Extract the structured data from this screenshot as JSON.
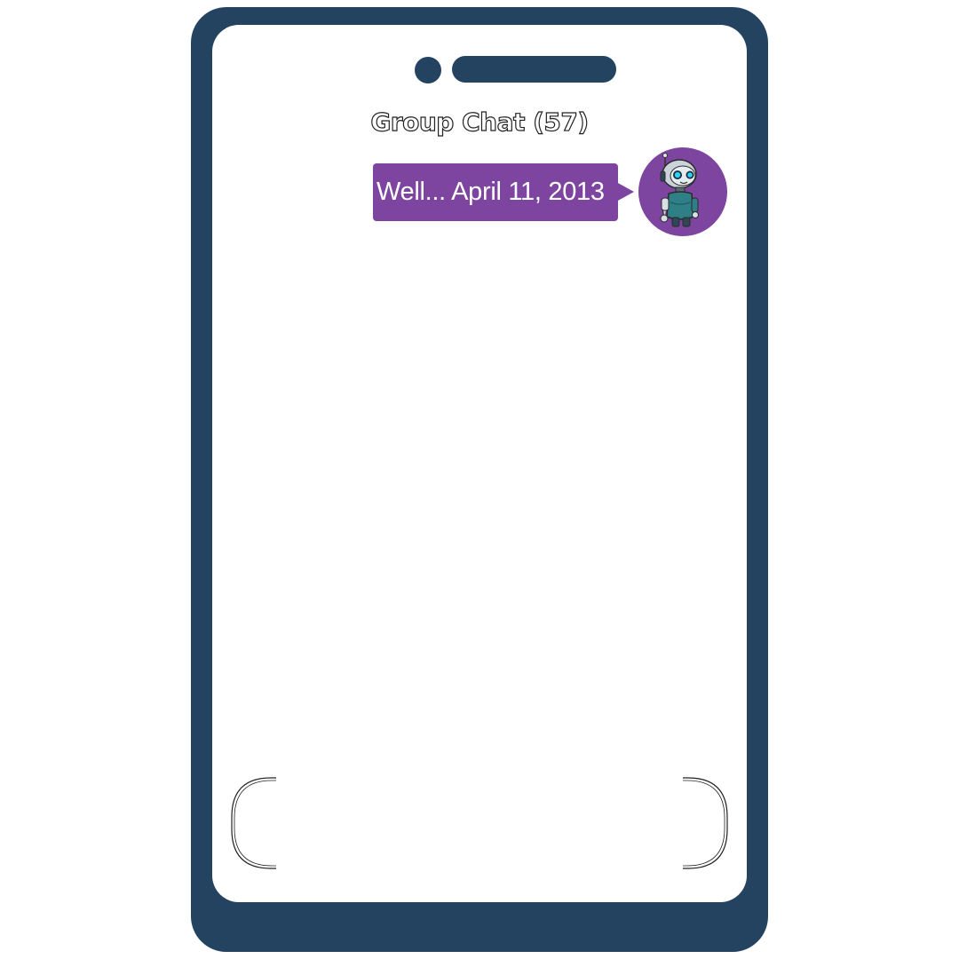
{
  "colors": {
    "phone_frame": "#244361",
    "screen": "#ffffff",
    "bubble": "#7d45a0",
    "avatar_bg": "#7d45a0"
  },
  "header": {
    "title": "Group Chat (57)"
  },
  "messages": [
    {
      "text": "Well... April 11, 2013",
      "avatar_icon": "robot-avatar-icon"
    }
  ],
  "icons": {
    "camera": "front-camera-icon",
    "speaker": "earpiece-speaker-icon"
  }
}
